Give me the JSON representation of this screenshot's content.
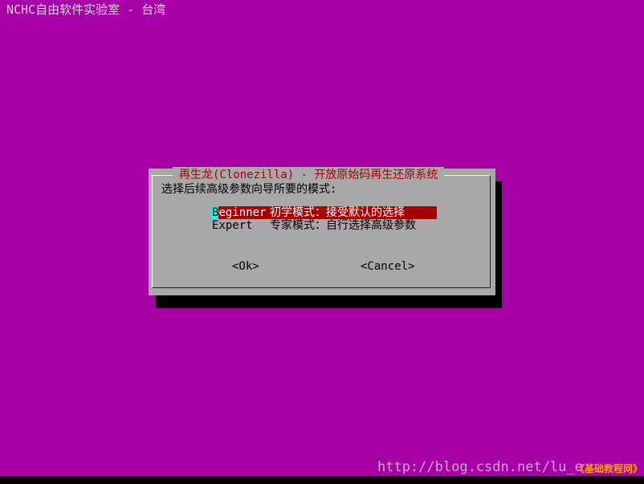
{
  "backtitle": "NCHC自由软件实验室 - 台湾",
  "dialog": {
    "title": "再生龙(Clonezilla) - 开放原始码再生还原系统",
    "prompt": "选择后续高级参数向导所要的模式:",
    "menu": [
      {
        "hotkey": "B",
        "tag_rest": "eginner",
        "description": "初学模式：接受默认的选择",
        "selected": true
      },
      {
        "hotkey": "E",
        "tag_rest": "xpert",
        "description": "专家模式：自行选择高级参数",
        "selected": false
      }
    ],
    "buttons": {
      "ok": "<Ok>",
      "cancel": "<Cancel>"
    }
  },
  "watermark": {
    "url": "http://blog.csdn.net/lu_e",
    "logo": "《基础教程网》"
  },
  "colors": {
    "background": "#a800a8",
    "dialog": "#a8a8a8",
    "title": "#a80000",
    "selection": "#a80000",
    "hotkey_highlight": "#00ffff",
    "shadow": "#000000"
  }
}
